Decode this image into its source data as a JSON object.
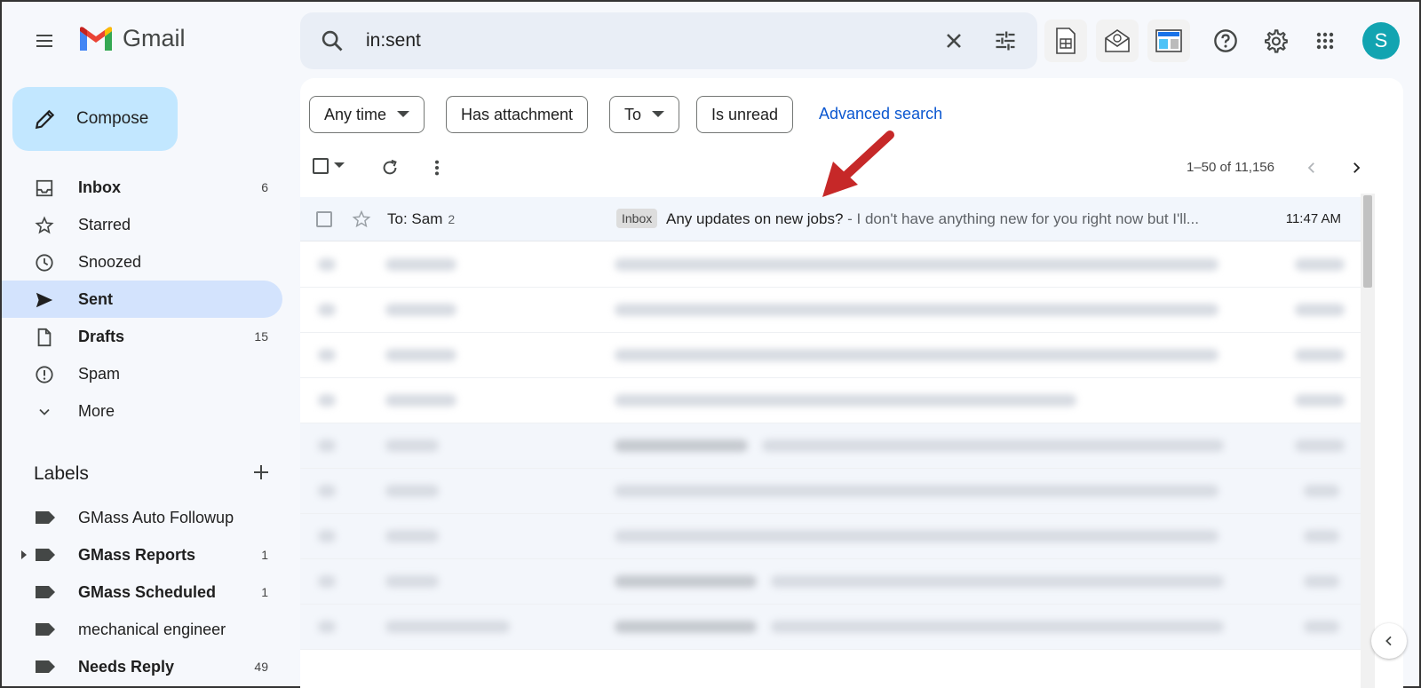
{
  "app": {
    "name": "Gmail"
  },
  "search": {
    "query": "in:sent"
  },
  "header": {
    "avatar_letter": "S"
  },
  "compose": {
    "label": "Compose"
  },
  "nav": [
    {
      "label": "Inbox",
      "count": "6",
      "bold": true,
      "icon": "inbox-icon"
    },
    {
      "label": "Starred",
      "count": "",
      "bold": false,
      "icon": "star-icon"
    },
    {
      "label": "Snoozed",
      "count": "",
      "bold": false,
      "icon": "clock-icon"
    },
    {
      "label": "Sent",
      "count": "",
      "bold": true,
      "icon": "send-icon",
      "active": true
    },
    {
      "label": "Drafts",
      "count": "15",
      "bold": true,
      "icon": "draft-icon"
    },
    {
      "label": "Spam",
      "count": "",
      "bold": false,
      "icon": "spam-icon"
    },
    {
      "label": "More",
      "count": "",
      "bold": false,
      "icon": "chevron-down-icon"
    }
  ],
  "labels": {
    "title": "Labels",
    "items": [
      {
        "label": "GMass Auto Followup",
        "count": "",
        "bold": false,
        "expandable": false
      },
      {
        "label": "GMass Reports",
        "count": "1",
        "bold": true,
        "expandable": true
      },
      {
        "label": "GMass Scheduled",
        "count": "1",
        "bold": true,
        "expandable": false
      },
      {
        "label": "mechanical engineer",
        "count": "",
        "bold": false,
        "expandable": false
      },
      {
        "label": "Needs Reply",
        "count": "49",
        "bold": true,
        "expandable": false
      }
    ]
  },
  "filters": {
    "any_time": "Any time",
    "has_attachment": "Has attachment",
    "to": "To",
    "is_unread": "Is unread",
    "advanced": "Advanced search"
  },
  "pager": {
    "range": "1–50 of 11,156"
  },
  "first_row": {
    "from": "To: Sam",
    "thread_count": "2",
    "badge": "Inbox",
    "subject": "Any updates on new jobs?",
    "snippet": " - I don't have anything new for you right now but I'll...",
    "time": "11:47 AM"
  },
  "colors": {
    "accent": "#0b57d0",
    "compose_bg": "#c2e7ff",
    "active_nav": "#d3e3fd",
    "arrow": "#c62828"
  }
}
